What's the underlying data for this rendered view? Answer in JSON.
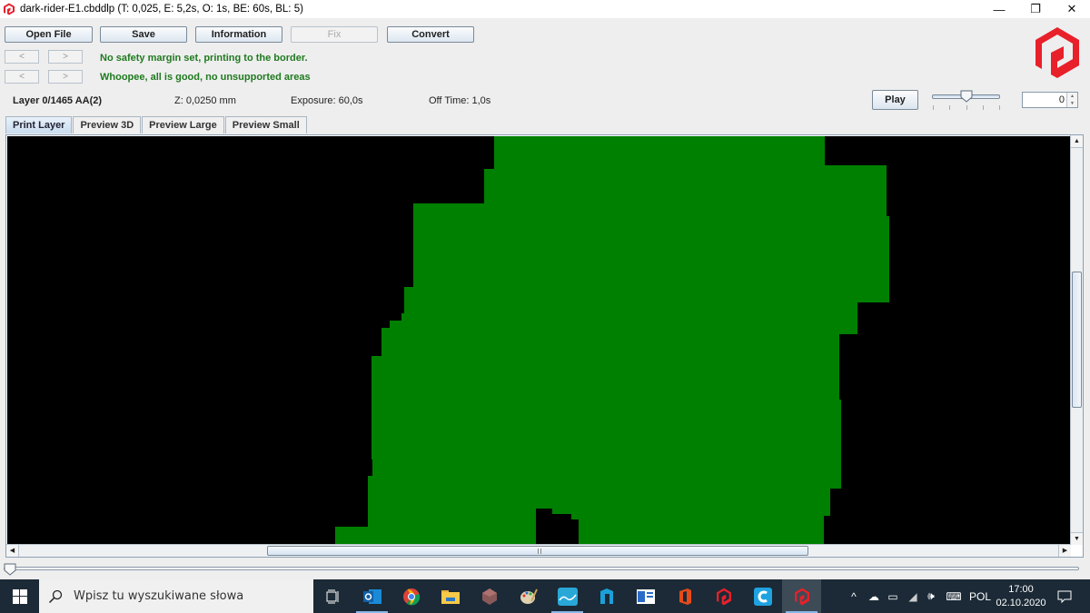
{
  "window": {
    "title": "dark-rider-E1.cbddlp (T: 0,025, E: 5,2s, O: 1s, BE: 60s, BL: 5)",
    "controls": {
      "minimize": "—",
      "restore": "❐",
      "close": "✕"
    }
  },
  "toolbar": {
    "open_file": "Open File",
    "save": "Save",
    "information": "Information",
    "fix": "Fix",
    "convert": "Convert"
  },
  "nav": {
    "prev": "<",
    "next": ">"
  },
  "messages": [
    "No safety margin set, printing to the border.",
    "Whoopee, all is good, no unsupported areas"
  ],
  "layer_info": {
    "layer": "Layer 0/1465 AA(2)",
    "z": "Z: 0,0250 mm",
    "exposure": "Exposure: 60,0s",
    "off_time": "Off Time: 1,0s"
  },
  "playback": {
    "play_label": "Play",
    "speed_slider_fraction": 0.5,
    "layer_spinner_value": "0"
  },
  "tabs": [
    {
      "label": "Print Layer",
      "active": true
    },
    {
      "label": "Preview 3D",
      "active": false
    },
    {
      "label": "Preview Large",
      "active": false
    },
    {
      "label": "Preview Small",
      "active": false
    }
  ],
  "layer_slider": {
    "value": 0,
    "max": 1465
  },
  "colors": {
    "layer_fill": "#008000",
    "layer_background": "#000000",
    "message_ok": "#1f7a1f",
    "logo_red": "#e8202a"
  },
  "taskbar": {
    "search_placeholder": "Wpisz tu wyszukiwane słowa",
    "apps": [
      {
        "name": "task-view",
        "icon": "task-view-icon"
      },
      {
        "name": "outlook",
        "icon": "outlook-icon"
      },
      {
        "name": "chrome",
        "icon": "chrome-icon"
      },
      {
        "name": "file-explorer",
        "icon": "folder-icon"
      },
      {
        "name": "3d-app",
        "icon": "polyhedron-icon"
      },
      {
        "name": "paint",
        "icon": "palette-icon"
      },
      {
        "name": "chart-app",
        "icon": "wave-chart-icon"
      },
      {
        "name": "cura-like",
        "icon": "blue-n-icon"
      },
      {
        "name": "window-app",
        "icon": "window-icon"
      },
      {
        "name": "office",
        "icon": "office-icon"
      },
      {
        "name": "photon-workshop",
        "icon": "photon-logo-icon"
      },
      {
        "name": "c-app",
        "icon": "c-letter-icon"
      },
      {
        "name": "photon-file-validator",
        "icon": "photon-logo-icon"
      }
    ],
    "tray": {
      "language": "POL",
      "time": "17:00",
      "date": "02.10.2020"
    }
  }
}
